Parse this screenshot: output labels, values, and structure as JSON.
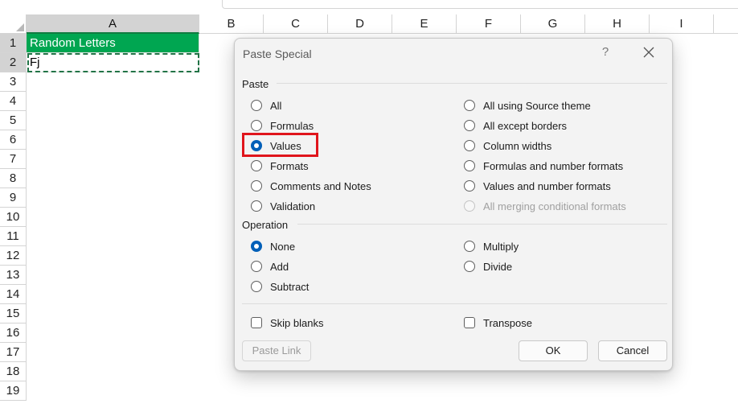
{
  "sheet": {
    "columns": [
      "A",
      "B",
      "C",
      "D",
      "E",
      "F",
      "G",
      "H",
      "I"
    ],
    "rows": [
      "1",
      "2",
      "3",
      "4",
      "5",
      "6",
      "7",
      "8",
      "9",
      "10",
      "11",
      "12",
      "13",
      "14",
      "15",
      "16",
      "17",
      "18",
      "19"
    ],
    "cells": {
      "A1": "Random Letters",
      "A2": "Fj"
    },
    "header_fill": "#00a651"
  },
  "dialog": {
    "title": "Paste Special",
    "help": "?",
    "paste_section": "Paste",
    "paste_options_left": [
      {
        "label": "All",
        "checked": false
      },
      {
        "label": "Formulas",
        "checked": false
      },
      {
        "label": "Values",
        "checked": true
      },
      {
        "label": "Formats",
        "checked": false
      },
      {
        "label": "Comments and Notes",
        "checked": false
      },
      {
        "label": "Validation",
        "checked": false
      }
    ],
    "paste_options_right": [
      {
        "label": "All using Source theme",
        "checked": false,
        "disabled": false
      },
      {
        "label": "All except borders",
        "checked": false,
        "disabled": false
      },
      {
        "label": "Column widths",
        "checked": false,
        "disabled": false
      },
      {
        "label": "Formulas and number formats",
        "checked": false,
        "disabled": false
      },
      {
        "label": "Values and number formats",
        "checked": false,
        "disabled": false
      },
      {
        "label": "All merging conditional formats",
        "checked": false,
        "disabled": true
      }
    ],
    "operation_section": "Operation",
    "operation_left": [
      {
        "label": "None",
        "checked": true
      },
      {
        "label": "Add",
        "checked": false
      },
      {
        "label": "Subtract",
        "checked": false
      }
    ],
    "operation_right": [
      {
        "label": "Multiply",
        "checked": false
      },
      {
        "label": "Divide",
        "checked": false
      }
    ],
    "skip_blanks": "Skip blanks",
    "transpose": "Transpose",
    "paste_link": "Paste Link",
    "ok": "OK",
    "cancel": "Cancel",
    "accent": "#005fb8",
    "highlight_color": "#e0151c"
  }
}
